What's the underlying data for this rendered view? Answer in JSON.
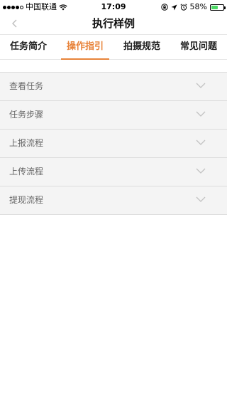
{
  "status_bar": {
    "carrier": "中国联通",
    "time": "17:09",
    "battery_percent": "58%",
    "battery_level": 0.58
  },
  "nav": {
    "title": "执行样例",
    "back_icon": "chevron-left-icon"
  },
  "tabs": [
    {
      "label": "任务简介",
      "active": false
    },
    {
      "label": "操作指引",
      "active": true
    },
    {
      "label": "拍摄规范",
      "active": false
    },
    {
      "label": "常见问题",
      "active": false
    }
  ],
  "sections": [
    {
      "label": "查看任务"
    },
    {
      "label": "任务步骤"
    },
    {
      "label": "上报流程"
    },
    {
      "label": "上传流程"
    },
    {
      "label": "提现流程"
    }
  ],
  "colors": {
    "accent": "#e8833a",
    "row_background": "#f4f4f4",
    "divider": "#dcdcdc",
    "battery": "#4cd964"
  }
}
